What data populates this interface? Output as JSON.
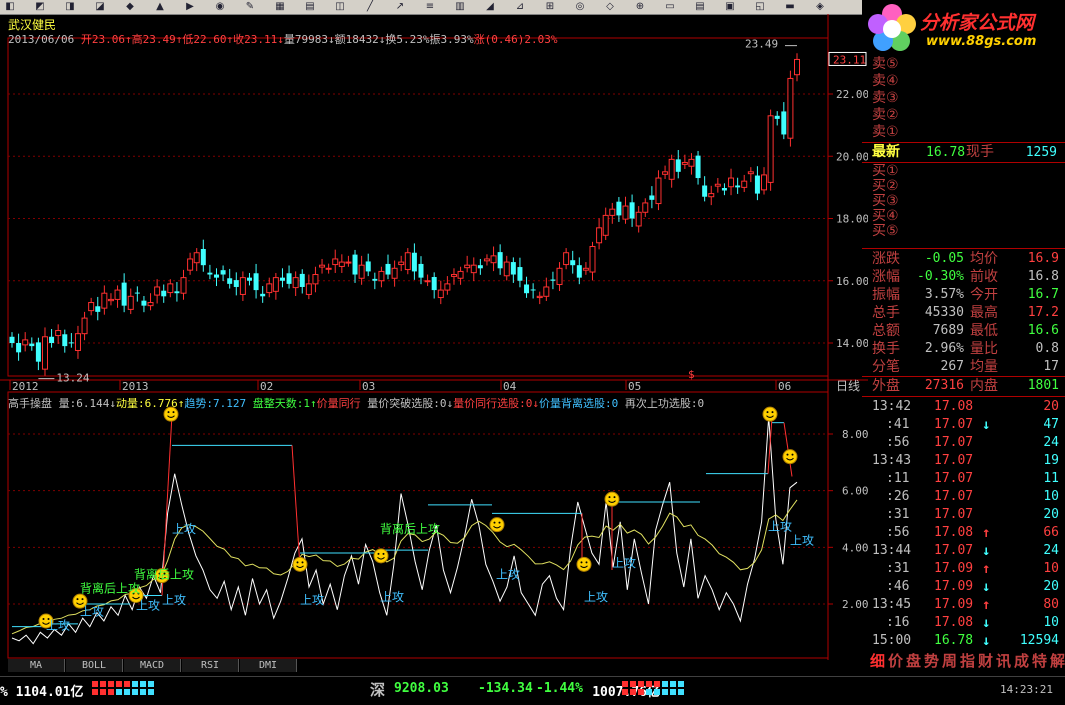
{
  "stock": {
    "name": "武汉健民",
    "info_line": [
      {
        "t": "2013/06/06 ",
        "c": "#c0c0c0"
      },
      {
        "t": "开23.06↑",
        "c": "#ff4040"
      },
      {
        "t": "高23.49↑",
        "c": "#ff4040"
      },
      {
        "t": "低22.60↑",
        "c": "#ff4040"
      },
      {
        "t": "收23.11↓",
        "c": "#ff4040"
      },
      {
        "t": "量79983↓",
        "c": "#c0c0c0"
      },
      {
        "t": "额18432↓",
        "c": "#c0c0c0"
      },
      {
        "t": "换5.23%",
        "c": "#c0c0c0"
      },
      {
        "t": "振3.93%",
        "c": "#c0c0c0"
      },
      {
        "t": "涨(0.46)2.03%",
        "c": "#ff4040"
      }
    ]
  },
  "price_axis": [
    "22.00",
    "20.00",
    "18.00",
    "16.00",
    "14.00"
  ],
  "price_current_tag": "23.11",
  "price_high_label": "23.49",
  "price_low_label": "13.24",
  "date_axis": [
    "2012",
    "2013",
    "02",
    "03",
    "04",
    "05",
    "06"
  ],
  "period_label": "日线",
  "indicator": {
    "title_parts": [
      {
        "t": "高手操盘 ",
        "c": "#c0c0c0"
      },
      {
        "t": "量:6.144↓",
        "c": "#c0c0c0"
      },
      {
        "t": "动量:6.776↑",
        "c": "#ffff40"
      },
      {
        "t": "趋势:7.127 ",
        "c": "#40c0ff"
      },
      {
        "t": "盘整天数:1↑",
        "c": "#40ff40"
      },
      {
        "t": "价量同行 ",
        "c": "#ff4040"
      },
      {
        "t": "量价突破选股:0↓",
        "c": "#c0c0c0"
      },
      {
        "t": "量价同行选股:0↓",
        "c": "#ff4040"
      },
      {
        "t": "价量背离选股:0 ",
        "c": "#40c0ff"
      },
      {
        "t": "再次上功选股:0",
        "c": "#c0c0c0"
      }
    ],
    "axis": [
      "8.00",
      "6.00",
      "4.00",
      "2.00"
    ],
    "attack_label": "上攻",
    "divergence_label": "背离后上攻"
  },
  "bottom_tabs": [
    "MA",
    "BOLL",
    "MACD",
    "RSI",
    "DMI"
  ],
  "logo": {
    "title": "分析家公式网",
    "url": "www.88gs.com"
  },
  "orderbook": {
    "sell": [
      "卖⑤",
      "卖④",
      "卖③",
      "卖②",
      "卖①"
    ],
    "buy": [
      "买①",
      "买②",
      "买③",
      "买④",
      "买⑤"
    ],
    "latest_label": "最新",
    "latest": "16.78",
    "volnow_label": "现手",
    "volnow": "1259"
  },
  "stats": [
    {
      "l1": "涨跌",
      "v1": "-0.05",
      "l2": "均价",
      "v2": "16.9"
    },
    {
      "l1": "涨幅",
      "v1": "-0.30%",
      "l2": "前收",
      "v2": "16.8"
    },
    {
      "l1": "振幅",
      "v1": "3.57%",
      "l2": "今开",
      "v2": "16.7"
    },
    {
      "l1": "总手",
      "v1": "45330",
      "l2": "最高",
      "v2": "17.2"
    },
    {
      "l1": "总额",
      "v1": "7689",
      "l2": "最低",
      "v2": "16.6"
    },
    {
      "l1": "换手",
      "v1": "2.96%",
      "l2": "量比",
      "v2": "0.8"
    },
    {
      "l1": "分笔",
      "v1": "267",
      "l2": "均量",
      "v2": "17"
    }
  ],
  "outer_inner": {
    "l1": "外盘",
    "v1": "27316",
    "l2": "内盘",
    "v2": "1801"
  },
  "ticks": [
    {
      "time": "13:42",
      "price": "17.08",
      "arrow": "",
      "vol": "20",
      "pc": "#ff4040",
      "vc": "#ff4040"
    },
    {
      "time": ":41",
      "price": "17.07",
      "arrow": "↓",
      "vol": "47",
      "pc": "#ff4040",
      "vc": "#40ffff"
    },
    {
      "time": ":56",
      "price": "17.07",
      "arrow": "",
      "vol": "24",
      "pc": "#ff4040",
      "vc": "#40ffff"
    },
    {
      "time": "13:43",
      "price": "17.07",
      "arrow": "",
      "vol": "19",
      "pc": "#ff4040",
      "vc": "#40ffff"
    },
    {
      "time": ":11",
      "price": "17.07",
      "arrow": "",
      "vol": "11",
      "pc": "#ff4040",
      "vc": "#40ffff"
    },
    {
      "time": ":26",
      "price": "17.07",
      "arrow": "",
      "vol": "10",
      "pc": "#ff4040",
      "vc": "#40ffff"
    },
    {
      "time": ":31",
      "price": "17.07",
      "arrow": "",
      "vol": "20",
      "pc": "#ff4040",
      "vc": "#40ffff"
    },
    {
      "time": ":56",
      "price": "17.08",
      "arrow": "↑",
      "vol": "66",
      "pc": "#ff4040",
      "vc": "#ff4040"
    },
    {
      "time": "13:44",
      "price": "17.07",
      "arrow": "↓",
      "vol": "24",
      "pc": "#ff4040",
      "vc": "#40ffff"
    },
    {
      "time": ":31",
      "price": "17.09",
      "arrow": "↑",
      "vol": "10",
      "pc": "#ff4040",
      "vc": "#ff4040"
    },
    {
      "time": ":46",
      "price": "17.09",
      "arrow": "↓",
      "vol": "20",
      "pc": "#ff4040",
      "vc": "#40ffff"
    },
    {
      "time": "13:45",
      "price": "17.09",
      "arrow": "↑",
      "vol": "80",
      "pc": "#ff4040",
      "vc": "#ff4040"
    },
    {
      "time": ":16",
      "price": "17.08",
      "arrow": "↓",
      "vol": "10",
      "pc": "#ff4040",
      "vc": "#40ffff"
    },
    {
      "time": "15:00",
      "price": "16.78",
      "arrow": "↓",
      "vol": "12594",
      "pc": "#40ff40",
      "vc": "#40ffff"
    }
  ],
  "side_tabs": [
    "细",
    "价",
    "盘",
    "势",
    "周",
    "指",
    "财",
    "讯",
    "成",
    "特",
    "解"
  ],
  "statusbar": {
    "left": "% 1104.01亿",
    "sz_label": "深",
    "sz_index": "9208.03",
    "sz_change": "-134.34",
    "sz_pct": "-1.44%",
    "sz_amount": "1007.76亿",
    "time": "14:23:21"
  },
  "colors": {
    "up": "#ff3030",
    "down": "#40ffff",
    "grid": "#800000",
    "axis": "#b00000"
  }
}
